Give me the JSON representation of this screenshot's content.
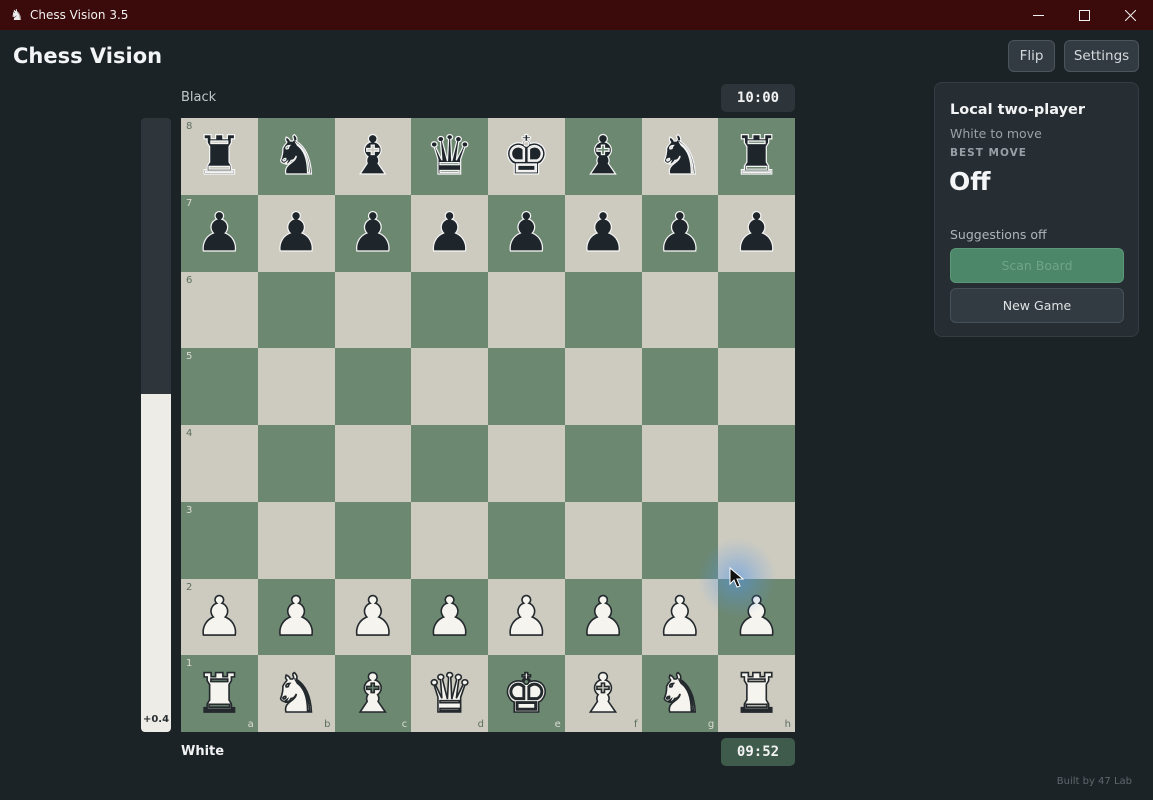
{
  "window": {
    "title": "Chess Vision 3.5",
    "controls": {
      "minimize": "—",
      "maximize": "☐",
      "close": "✕"
    }
  },
  "header": {
    "title": "Chess Vision",
    "flip_label": "Flip",
    "settings_label": "Settings"
  },
  "players": {
    "top": {
      "name": "Black",
      "clock": "10:00"
    },
    "bottom": {
      "name": "White",
      "clock": "09:52"
    }
  },
  "evaluation": {
    "label": "+0.4",
    "white_fraction": 0.55
  },
  "board": {
    "colors": {
      "light": "#cdcbc0",
      "dark": "#6d8871"
    },
    "ranks": [
      "8",
      "7",
      "6",
      "5",
      "4",
      "3",
      "2",
      "1"
    ],
    "files": [
      "a",
      "b",
      "c",
      "d",
      "e",
      "f",
      "g",
      "h"
    ],
    "rows": [
      [
        "bR",
        "bN",
        "bB",
        "bQ",
        "bK",
        "bB",
        "bN",
        "bR"
      ],
      [
        "bP",
        "bP",
        "bP",
        "bP",
        "bP",
        "bP",
        "bP",
        "bP"
      ],
      [
        "",
        "",
        "",
        "",
        "",
        "",
        "",
        ""
      ],
      [
        "",
        "",
        "",
        "",
        "",
        "",
        "",
        ""
      ],
      [
        "",
        "",
        "",
        "",
        "",
        "",
        "",
        ""
      ],
      [
        "",
        "",
        "",
        "",
        "",
        "",
        "",
        ""
      ],
      [
        "wP",
        "wP",
        "wP",
        "wP",
        "wP",
        "wP",
        "wP",
        "wP"
      ],
      [
        "wR",
        "wN",
        "wB",
        "wQ",
        "wK",
        "wB",
        "wN",
        "wR"
      ]
    ],
    "pieces": {
      "K": {
        "glyph": "♚",
        "icon": "king-icon"
      },
      "Q": {
        "glyph": "♛",
        "icon": "queen-icon"
      },
      "R": {
        "glyph": "♜",
        "icon": "rook-icon"
      },
      "B": {
        "glyph": "♝",
        "icon": "bishop-icon"
      },
      "N": {
        "glyph": "♞",
        "icon": "knight-icon"
      },
      "P": {
        "glyph": "♟",
        "icon": "pawn-icon"
      }
    }
  },
  "panel": {
    "title": "Local two-player",
    "status": "White to move",
    "best_move_label": "BEST MOVE",
    "best_move_value": "Off",
    "suggestions_label": "Suggestions off",
    "scan_button": "Scan Board",
    "new_game_button": "New Game"
  },
  "footer": {
    "text": "Built by 47 Lab"
  },
  "colors": {
    "titlebar": "#3b0b0b",
    "accent": "#4b8768",
    "background": "#1c2327"
  }
}
